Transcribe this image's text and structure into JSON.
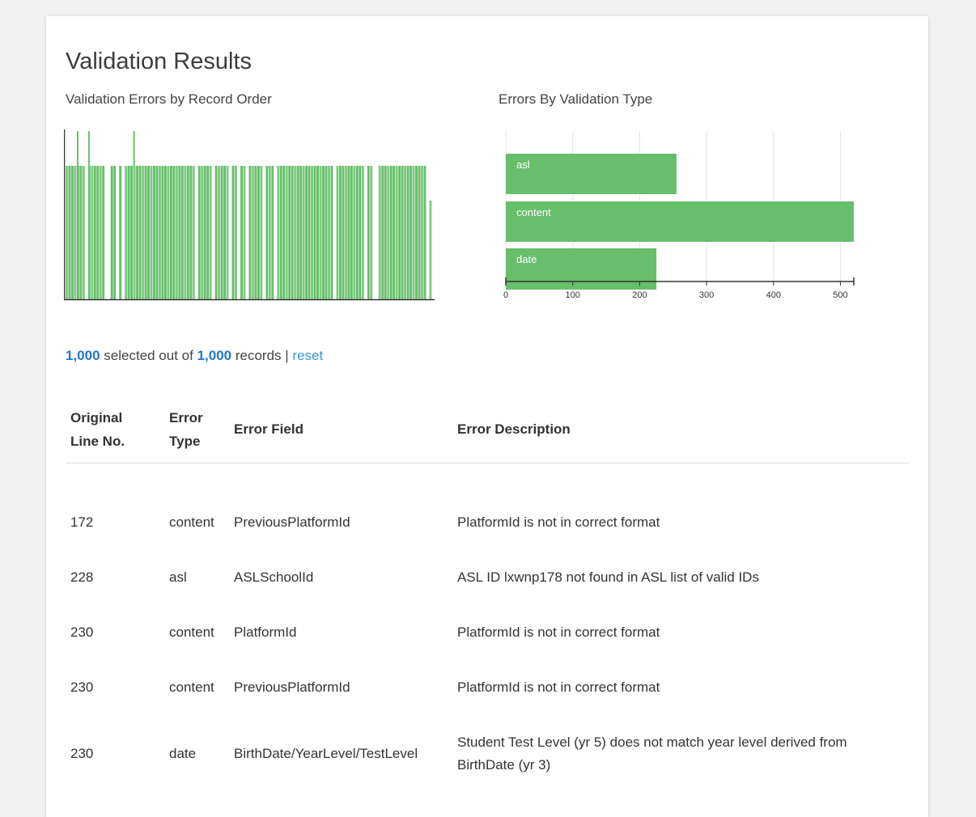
{
  "page": {
    "title": "Validation Results"
  },
  "chart_record": {
    "title": "Validation Errors by Record Order"
  },
  "colors": {
    "bar": "#67bf6b",
    "bar_light": "#7ecb81",
    "link": "#3a96d8",
    "number": "#1f77c8"
  },
  "chart_data": [
    {
      "type": "bar",
      "title": "Validation Errors by Record Order",
      "note": "histogram of error counts across records; nearly all records show errors at a common level with a few gaps and a few taller spikes near the start",
      "values_level": "most records",
      "ylim": [
        0,
        1
      ]
    },
    {
      "type": "bar",
      "orientation": "horizontal",
      "title": "Errors By Validation Type",
      "categories": [
        "asl",
        "content",
        "date"
      ],
      "values": [
        255,
        520,
        225
      ],
      "xlim": [
        0,
        520
      ],
      "x_ticks": [
        0,
        100,
        200,
        300,
        400,
        500
      ],
      "grid": true
    }
  ],
  "chart_type": {
    "title": "Errors By Validation Type",
    "tick_labels": [
      "0",
      "100",
      "200",
      "300",
      "400",
      "500"
    ]
  },
  "summary": {
    "selected": "1,000",
    "text_selected": " selected out of ",
    "total": "1,000",
    "text_records": " records | ",
    "reset": "reset"
  },
  "table": {
    "headers": {
      "line": [
        "Original",
        "Line No."
      ],
      "type": [
        "Error",
        "Type"
      ],
      "field": "Error Field",
      "description": "Error Description"
    },
    "rows": [
      {
        "line": "172",
        "type": "content",
        "field": "PreviousPlatformId",
        "description": "PlatformId is not in correct format"
      },
      {
        "line": "228",
        "type": "asl",
        "field": "ASLSchoolId",
        "description": "ASL ID lxwnp178 not found in ASL list of valid IDs"
      },
      {
        "line": "230",
        "type": "content",
        "field": "PlatformId",
        "description": "PlatformId is not in correct format"
      },
      {
        "line": "230",
        "type": "content",
        "field": "PreviousPlatformId",
        "description": "PlatformId is not in correct format"
      },
      {
        "line": "230",
        "type": "date",
        "field": "BirthDate/YearLevel/TestLevel",
        "description": "Student Test Level (yr 5) does not match year level derived from BirthDate (yr 3)"
      }
    ]
  }
}
